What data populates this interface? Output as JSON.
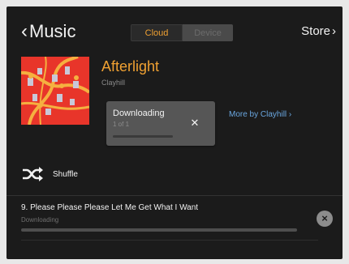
{
  "header": {
    "back_label": "Music",
    "back_icon": "chevron-left-icon",
    "tabs": [
      {
        "label": "Cloud",
        "active": true
      },
      {
        "label": "Device",
        "active": false
      }
    ],
    "store_label": "Store",
    "store_icon": "chevron-right-icon"
  },
  "album": {
    "title": "Afterlight",
    "artist": "Clayhill"
  },
  "download": {
    "title": "Downloading",
    "count": "1 of 1",
    "progress": 0.0,
    "close_icon": "close-icon"
  },
  "more_link": "More by Clayhill ›",
  "shuffle": {
    "label": "Shuffle",
    "icon": "shuffle-icon"
  },
  "track": {
    "title": "9. Please Please Please Let Me Get What I Want",
    "status": "Downloading",
    "progress": 0.0,
    "cancel_icon": "close-circle-icon"
  },
  "colors": {
    "accent": "#f0a132",
    "link": "#6aa7e0",
    "background": "#1b1b1b",
    "album_art": "#e8352a"
  }
}
